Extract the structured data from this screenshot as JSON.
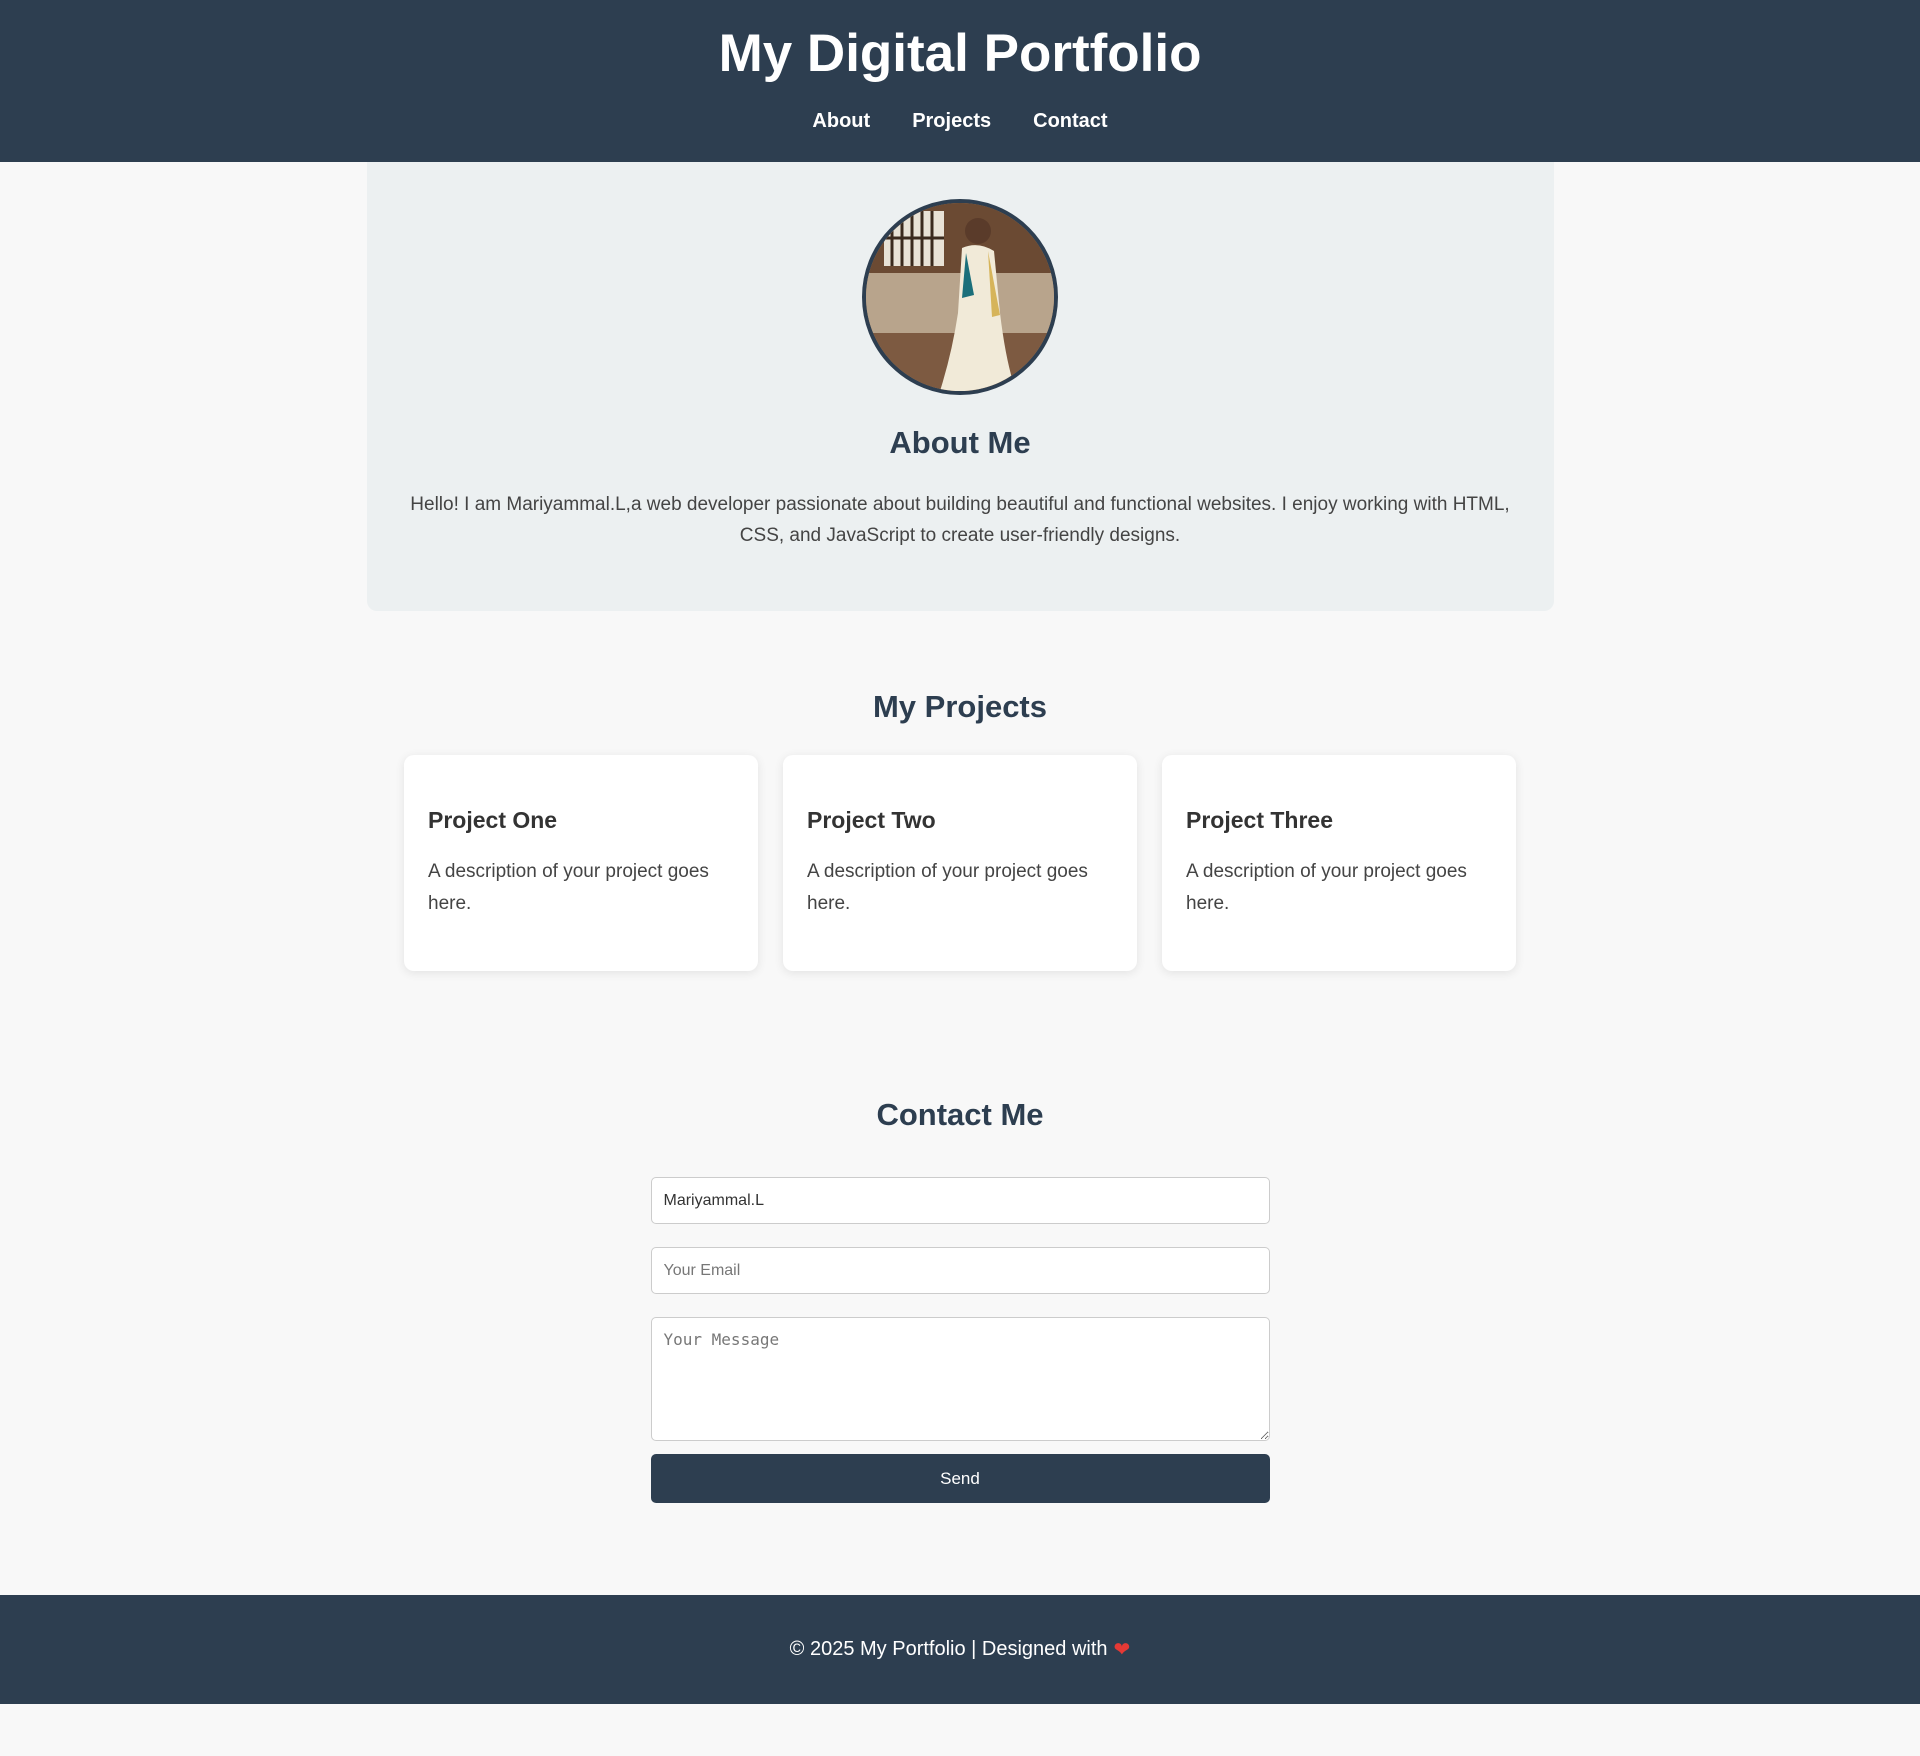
{
  "header": {
    "title": "My Digital Portfolio",
    "nav": [
      {
        "label": "About"
      },
      {
        "label": "Projects"
      },
      {
        "label": "Contact"
      }
    ]
  },
  "about": {
    "heading": "About Me",
    "text": "Hello! I am Mariyammal.L,a web developer passionate about building beautiful and functional websites. I enjoy working with HTML, CSS, and JavaScript to create user-friendly designs."
  },
  "projects": {
    "heading": "My Projects",
    "items": [
      {
        "title": "Project One",
        "description": "A description of your project goes here."
      },
      {
        "title": "Project Two",
        "description": "A description of your project goes here."
      },
      {
        "title": "Project Three",
        "description": "A description of your project goes here."
      }
    ]
  },
  "contact": {
    "heading": "Contact Me",
    "name_value": "Mariyammal.L",
    "email_placeholder": "Your Email",
    "message_placeholder": "Your Message",
    "send_label": "Send"
  },
  "footer": {
    "text": "© 2025 My Portfolio | Designed with",
    "heart": "❤"
  },
  "colors": {
    "primary": "#2d3e50",
    "background": "#f8f8f8",
    "about_background": "#ecf0f1",
    "heart": "#e53935"
  }
}
